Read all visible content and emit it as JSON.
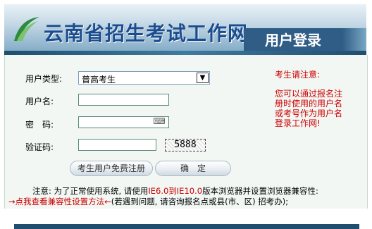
{
  "header": {
    "site_title": "云南省招生考试工作网",
    "section_title": "用户登录"
  },
  "form": {
    "user_type_label": "用户类型:",
    "user_type_value": "普高考生",
    "username_label": "用户名:",
    "username_value": "",
    "password_label": "密　码:",
    "password_value": "",
    "captcha_label": "验证码:",
    "captcha_value": "",
    "captcha_image_text": "5888"
  },
  "buttons": {
    "register_label": "考生用户免费注册",
    "confirm_label": "确　定"
  },
  "notice": {
    "title": "考生请注意:",
    "body": "您可以通过报名注册时使用的用户名或考号作为用户名登录工作网!"
  },
  "footnote": {
    "line1_prefix": "注意: 为了正常使用系统, 请使用",
    "line1_browsers": "IE6.0到IE10.0",
    "line1_suffix": "版本浏览器并设置浏览器兼容性:",
    "line2_link": "→点我查看兼容性设置方法←",
    "line2_suffix": "(若遇到问题, 请咨询报名点或县(市、区) 招考办);"
  },
  "colors": {
    "title_blue": "#1a4d8f",
    "banner_dark": "#2f5d86",
    "panel_bg": "#f2f7f4",
    "notice_red": "#cc0000"
  },
  "icons": {
    "logo": "green-swoosh-logo",
    "keyboard": "keyboard-icon",
    "dropdown": "chevron-down-icon"
  }
}
